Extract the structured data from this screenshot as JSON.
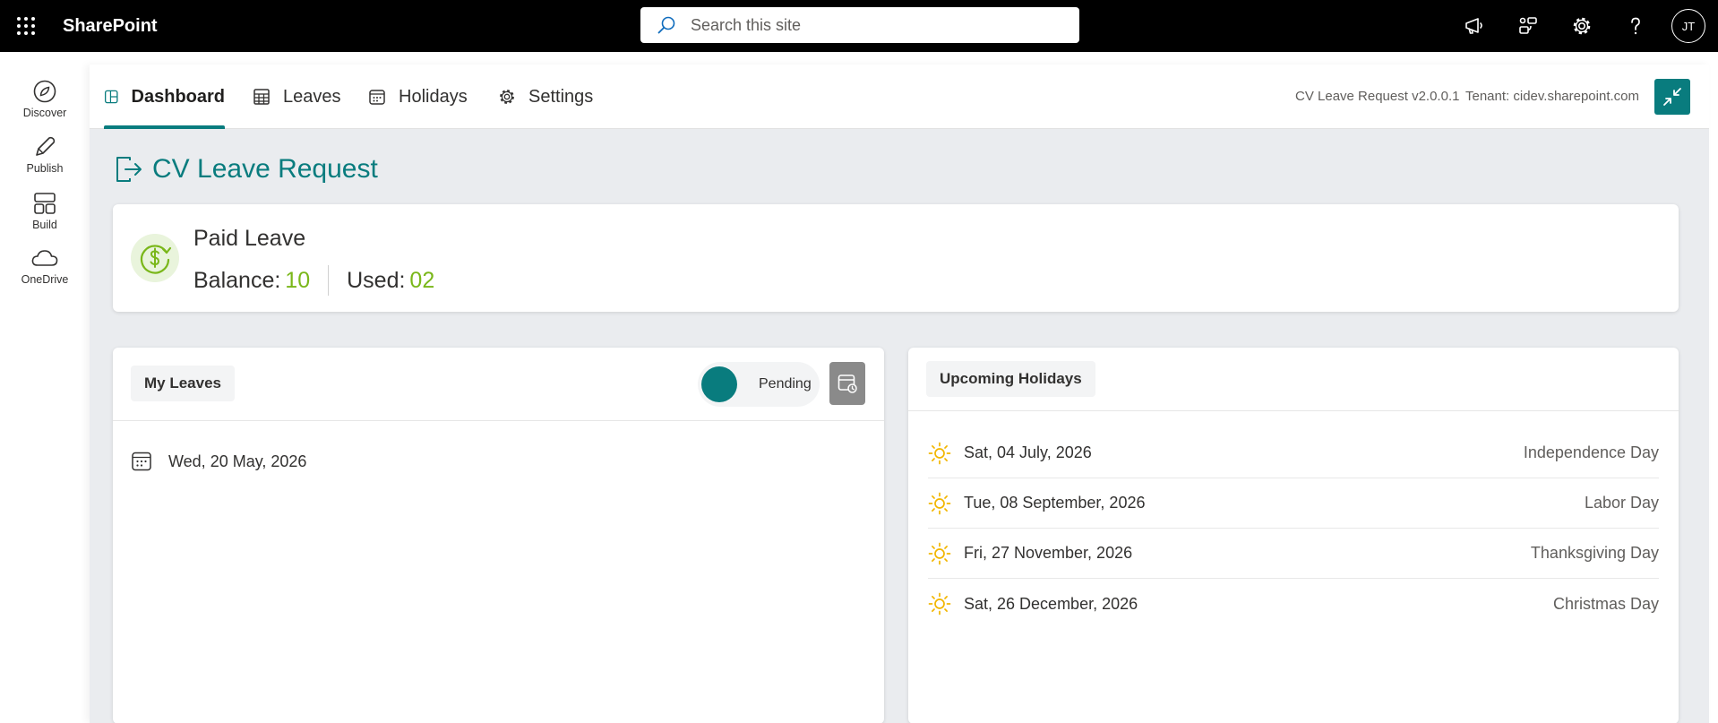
{
  "suite": {
    "brand": "SharePoint",
    "search_placeholder": "Search this site",
    "avatar_initials": "JT",
    "icons": [
      "waffle-icon",
      "search-icon",
      "megaphone-icon",
      "share-icon",
      "gear-icon",
      "help-icon"
    ]
  },
  "appbar": {
    "items": [
      {
        "label": "Discover",
        "icon": "compass-icon"
      },
      {
        "label": "Publish",
        "icon": "pen-icon"
      },
      {
        "label": "Build",
        "icon": "layout-icon"
      },
      {
        "label": "OneDrive",
        "icon": "cloud-icon"
      }
    ]
  },
  "nav": {
    "tabs": [
      {
        "label": "Dashboard",
        "icon": "dashboard-icon",
        "active": true
      },
      {
        "label": "Leaves",
        "icon": "table-icon"
      },
      {
        "label": "Holidays",
        "icon": "calendar-icon"
      },
      {
        "label": "Settings",
        "icon": "gear-icon"
      }
    ],
    "version": "CV Leave Request v2.0.0.1",
    "tenant": "Tenant: cidev.sharepoint.com"
  },
  "page": {
    "title": "CV Leave Request"
  },
  "leave_summary": {
    "name": "Paid Leave",
    "balance_label": "Balance:",
    "balance_value": "10",
    "used_label": "Used:",
    "used_value": "02"
  },
  "my_leaves": {
    "title": "My Leaves",
    "toggle_label": "Pending",
    "items": [
      {
        "date": "Wed, 20 May, 2026"
      }
    ]
  },
  "holidays": {
    "title": "Upcoming Holidays",
    "items": [
      {
        "date": "Sat, 04 July, 2026",
        "name": "Independence Day"
      },
      {
        "date": "Tue, 08 September, 2026",
        "name": "Labor Day"
      },
      {
        "date": "Fri, 27 November, 2026",
        "name": "Thanksgiving Day"
      },
      {
        "date": "Sat, 26 December, 2026",
        "name": "Christmas Day"
      }
    ]
  },
  "colors": {
    "accent": "#097c7e",
    "value_green": "#7ab71a",
    "sun_yellow": "#f2b600"
  }
}
